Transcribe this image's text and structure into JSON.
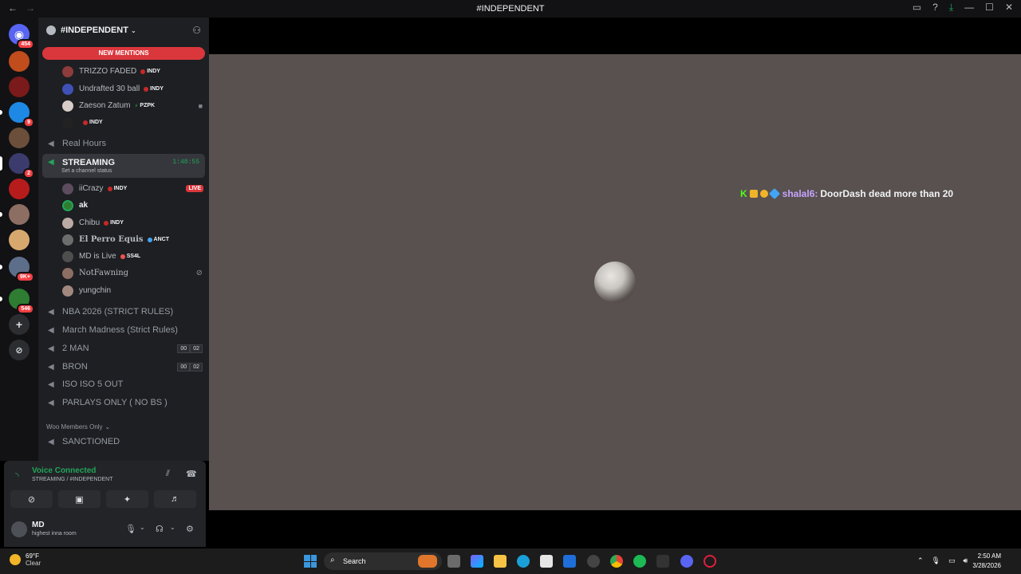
{
  "window": {
    "title": "#INDEPENDENT"
  },
  "guilds": [
    {
      "badge": "454"
    },
    {
      "badge": ""
    },
    {
      "badge": ""
    },
    {
      "badge": "9"
    },
    {
      "badge": ""
    },
    {
      "badge": "2"
    },
    {
      "badge": ""
    },
    {
      "badge": ""
    },
    {
      "badge": ""
    },
    {
      "badge": "9K+"
    },
    {
      "badge": "546"
    }
  ],
  "server": {
    "name": "#INDEPENDENT",
    "new_mentions": "NEW MENTIONS"
  },
  "voice_users_top": [
    {
      "name": "TRIZZO FADED",
      "tag": "INDY"
    },
    {
      "name": "Undrafted 30 ball",
      "tag": "INDY"
    },
    {
      "name": "Zaeson Zatum",
      "tag": "PZPK"
    },
    {
      "name": "",
      "tag": "INDY"
    }
  ],
  "channels": {
    "real_hours": "Real   Hours",
    "streaming": {
      "name": "STREAMING",
      "status": "Set a channel status",
      "timer": "1:48:55"
    },
    "nba": "NBA 2026 (STRICT RULES)",
    "march": "March Madness (Strict Rules)",
    "two_man": {
      "name": "2 MAN",
      "a": "00",
      "b": "02"
    },
    "bron": {
      "name": "BRON",
      "a": "00",
      "b": "02"
    },
    "iso": "ISO ISO 5 OUT",
    "parlays": "PARLAYS ONLY ( NO BS )",
    "category": "Woo Members Only",
    "sanctioned": "SANCTIONED"
  },
  "streaming_users": [
    {
      "name": "iiCrazy",
      "tag": "INDY",
      "live": "LIVE"
    },
    {
      "name": "ak",
      "tag": "",
      "live": ""
    },
    {
      "name": "Chibu",
      "tag": "INDY",
      "live": ""
    },
    {
      "name": "El Perro Equis",
      "tag": "ANCT",
      "live": ""
    },
    {
      "name": "MD is Live",
      "tag": "SS4L",
      "live": ""
    },
    {
      "name": "NotFawning",
      "tag": "",
      "live": ""
    },
    {
      "name": "yungchin",
      "tag": "",
      "live": ""
    }
  ],
  "voice_panel": {
    "status": "Voice Connected",
    "channel": "STREAMING / #INDEPENDENT"
  },
  "user": {
    "name": "MD",
    "status": "highest inna room"
  },
  "stream_chat": {
    "username": "shalal6:",
    "message": "DoorDash dead more than 20"
  },
  "taskbar": {
    "weather_temp": "69°F",
    "weather_desc": "Clear",
    "search": "Search",
    "time": "2:50 AM",
    "date": "3/28/2026"
  },
  "colors": {
    "accent_green": "#23a55a",
    "mention_red": "#da373c",
    "stage_bg": "#58514f"
  }
}
